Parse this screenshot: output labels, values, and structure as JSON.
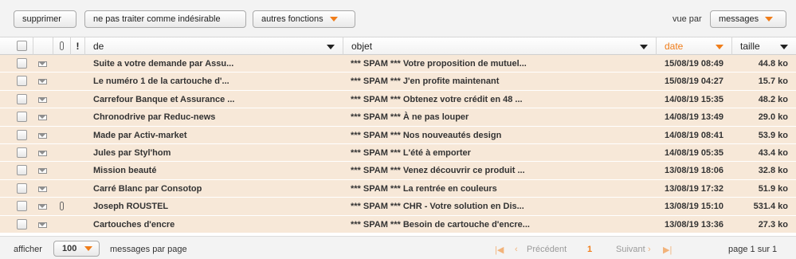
{
  "toolbar": {
    "delete_label": "supprimer",
    "not_spam_label": "ne pas traiter comme indésirable",
    "more_label": "autres fonctions",
    "view_by_label": "vue par",
    "view_by_value": "messages"
  },
  "columns": {
    "from": "de",
    "subject": "objet",
    "date": "date",
    "size": "taille"
  },
  "messages": [
    {
      "from": "Suite a votre demande par Assu...",
      "subject": "*** SPAM *** Votre proposition de mutuel...",
      "date": "15/08/19 08:49",
      "size": "44.8 ko",
      "attachment": false
    },
    {
      "from": "Le numéro 1 de la cartouche d'...",
      "subject": "*** SPAM *** J'en profite maintenant",
      "date": "15/08/19 04:27",
      "size": "15.7 ko",
      "attachment": false
    },
    {
      "from": "Carrefour Banque et Assurance ...",
      "subject": "*** SPAM *** Obtenez votre crédit en 48 ...",
      "date": "14/08/19 15:35",
      "size": "48.2 ko",
      "attachment": false
    },
    {
      "from": "Chronodrive par Reduc-news",
      "subject": "*** SPAM *** À ne pas louper",
      "date": "14/08/19 13:49",
      "size": "29.0 ko",
      "attachment": false
    },
    {
      "from": "Made par Activ-market",
      "subject": "*** SPAM *** Nos nouveautés design",
      "date": "14/08/19 08:41",
      "size": "53.9 ko",
      "attachment": false
    },
    {
      "from": "Jules par Styl'hom",
      "subject": "*** SPAM *** L'été à emporter",
      "date": "14/08/19 05:35",
      "size": "43.4 ko",
      "attachment": false
    },
    {
      "from": "Mission beauté",
      "subject": "*** SPAM *** Venez découvrir ce produit ...",
      "date": "13/08/19 18:06",
      "size": "32.8 ko",
      "attachment": false
    },
    {
      "from": "Carré Blanc par Consotop",
      "subject": "*** SPAM *** La rentrée en couleurs",
      "date": "13/08/19 17:32",
      "size": "51.9 ko",
      "attachment": false
    },
    {
      "from": "Joseph ROUSTEL",
      "subject": "*** SPAM *** CHR - Votre solution en Dis...",
      "date": "13/08/19 15:10",
      "size": "531.4 ko",
      "attachment": true
    },
    {
      "from": "Cartouches d'encre",
      "subject": "*** SPAM *** Besoin de cartouche d'encre...",
      "date": "13/08/19 13:36",
      "size": "27.3 ko",
      "attachment": false
    }
  ],
  "footer": {
    "show_label": "afficher",
    "per_page_value": "100",
    "per_page_label": "messages par page",
    "prev_label": "Précédent",
    "current_page": "1",
    "next_label": "Suivant",
    "page_info": "page 1 sur 1"
  },
  "colors": {
    "accent": "#f07d1a",
    "row_background": "#f7e8d8",
    "toolbar_background": "#f3f3f3"
  }
}
